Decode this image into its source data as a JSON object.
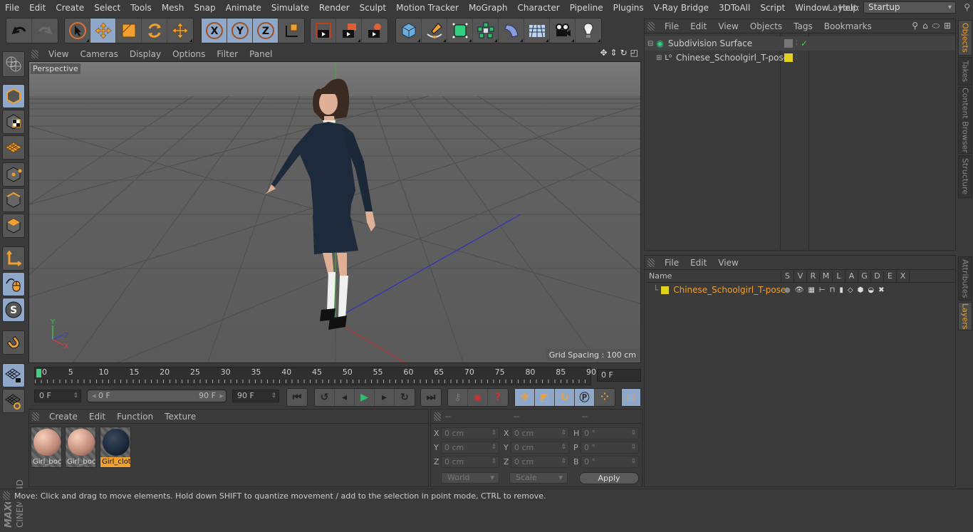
{
  "menubar": {
    "items": [
      "File",
      "Edit",
      "Create",
      "Select",
      "Tools",
      "Mesh",
      "Snap",
      "Animate",
      "Simulate",
      "Render",
      "Sculpt",
      "Motion Tracker",
      "MoGraph",
      "Character",
      "Pipeline",
      "Plugins",
      "V-Ray Bridge",
      "3DToAll",
      "Script",
      "Window",
      "Help"
    ],
    "layout_label": "Layout:",
    "layout_value": "Startup"
  },
  "toolbar": {
    "icons": [
      "undo-icon",
      "redo-icon",
      "live-selection-icon",
      "move-icon",
      "scale-icon",
      "rotate-icon",
      "recent-tool-icon",
      "x-axis-icon",
      "y-axis-icon",
      "z-axis-icon",
      "coordinate-system-icon",
      "render-view-icon",
      "render-picture-viewer-icon",
      "render-settings-icon",
      "cube-icon",
      "pen-icon",
      "subdivision-icon",
      "cloner-icon",
      "deformer-icon",
      "floor-icon",
      "camera-icon",
      "light-icon"
    ]
  },
  "left_tools": [
    "make-editable",
    "model-mode",
    "texture-mode",
    "workplane-mode",
    "points-mode",
    "edges-mode",
    "polygons-mode",
    "axis-mode",
    "tweak-mode",
    "solo-mode",
    "snap",
    "workplane-lock",
    "workplane-align"
  ],
  "brand": {
    "maker": "MAXON",
    "product": "CINEMA 4D"
  },
  "viewport": {
    "menu": [
      "View",
      "Cameras",
      "Display",
      "Options",
      "Filter",
      "Panel"
    ],
    "camera_label": "Perspective",
    "grid_spacing": "Grid Spacing : 100 cm",
    "axis_labels": {
      "x": "X",
      "y": "Y",
      "z": "Z"
    }
  },
  "timeline": {
    "ticks": [
      "0",
      "5",
      "10",
      "15",
      "20",
      "25",
      "30",
      "35",
      "40",
      "45",
      "50",
      "55",
      "60",
      "65",
      "70",
      "75",
      "80",
      "85",
      "90"
    ],
    "current_frame": "0 F",
    "start_field": "0 F",
    "range_start": "0 F",
    "range_end": "90 F",
    "end_field": "90 F"
  },
  "material_manager": {
    "menu": [
      "Create",
      "Edit",
      "Function",
      "Texture"
    ],
    "materials": [
      {
        "name": "Girl_boc",
        "selected": false,
        "color": "#d8a890"
      },
      {
        "name": "Girl_boc",
        "selected": false,
        "color": "#d8a890"
      },
      {
        "name": "Girl_clot",
        "selected": true,
        "color": "#1c2a3c"
      }
    ]
  },
  "coordinates": {
    "headers": [
      "--",
      "--",
      "--"
    ],
    "rows": [
      {
        "l1": "X",
        "v1": "0 cm",
        "l2": "X",
        "v2": "0 cm",
        "l3": "H",
        "v3": "0 °"
      },
      {
        "l1": "Y",
        "v1": "0 cm",
        "l2": "Y",
        "v2": "0 cm",
        "l3": "P",
        "v3": "0 °"
      },
      {
        "l1": "Z",
        "v1": "0 cm",
        "l2": "Z",
        "v2": "0 cm",
        "l3": "B",
        "v3": "0 °"
      }
    ],
    "mode": "World",
    "type": "Scale",
    "apply_label": "Apply"
  },
  "status": "Move: Click and drag to move elements. Hold down SHIFT to quantize movement / add to the selection in point mode, CTRL to remove.",
  "objects_panel": {
    "menu": [
      "File",
      "Edit",
      "View",
      "Objects",
      "Tags",
      "Bookmarks"
    ],
    "objects": [
      {
        "name": "Subdivision Surface",
        "icon": "subdivision-icon"
      },
      {
        "name": "Chinese_Schoolgirl_T-pose",
        "icon": "null-icon"
      }
    ]
  },
  "layers_panel": {
    "menu": [
      "File",
      "Edit",
      "View"
    ],
    "columns": [
      "Name",
      "S",
      "V",
      "R",
      "M",
      "L",
      "A",
      "G",
      "D",
      "E",
      "X"
    ],
    "layers": [
      {
        "name": "Chinese_Schoolgirl_T-pose",
        "color": "#e0d020"
      }
    ]
  },
  "side_tabs": {
    "top": [
      {
        "label": "Objects",
        "active": true
      },
      {
        "label": "Takes",
        "active": false
      },
      {
        "label": "Content Browser",
        "active": false
      },
      {
        "label": "Structure",
        "active": false
      }
    ],
    "bottom": [
      {
        "label": "Attributes",
        "active": false
      },
      {
        "label": "Layers",
        "active": true
      }
    ]
  },
  "colors": {
    "accent": "#f0a030",
    "selected_tool": "#8fa7c9",
    "layer_yellow": "#e0d020"
  }
}
